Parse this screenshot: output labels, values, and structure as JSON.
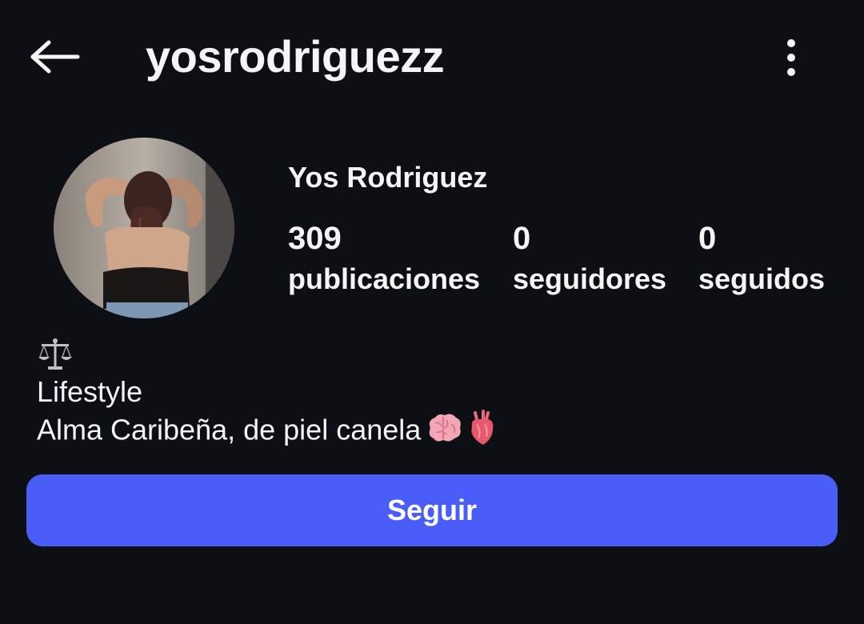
{
  "header": {
    "username": "yosrodriguezz",
    "back_icon": "arrow-left-icon",
    "more_icon": "more-vertical-icon"
  },
  "profile": {
    "display_name": "Yos Rodriguez",
    "avatar_icon": "profile-photo",
    "stats": [
      {
        "value": "309",
        "label": "publicaciones"
      },
      {
        "value": "0",
        "label": "seguidores"
      },
      {
        "value": "0",
        "label": "seguidos"
      }
    ]
  },
  "bio": {
    "icon": "scales-icon",
    "lines": [
      "Lifestyle",
      "Alma Caribeña, de piel canela"
    ],
    "trailing_emojis": [
      "brain-emoji",
      "anatomical-heart-emoji"
    ]
  },
  "actions": {
    "follow_label": "Seguir"
  },
  "colors": {
    "background": "#0c1014",
    "text": "#f5f5f5",
    "accent": "#4a5df9"
  }
}
